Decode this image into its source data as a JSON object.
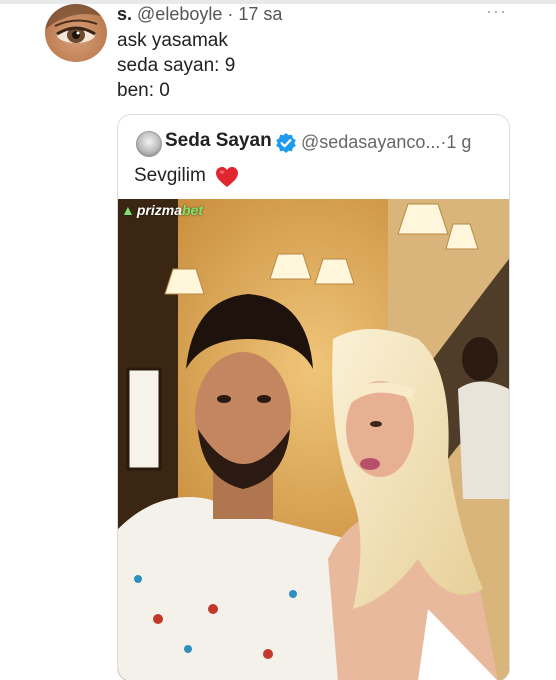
{
  "tweet": {
    "display_name": "s.",
    "handle": "@eleboyle",
    "time": "17 sa",
    "lines": [
      "ask yasamak",
      "seda sayan: 9",
      "ben: 0"
    ],
    "more_icon": "ellipsis-icon"
  },
  "quote": {
    "display_name": "Seda Sayan",
    "handle": "@sedasayanco...",
    "time": "1 g",
    "text": "Sevgilim",
    "verified_icon": "verified-badge-icon",
    "emoji": "red-heart-icon",
    "watermark": {
      "part1": "prizma",
      "part2": "bet"
    }
  },
  "colors": {
    "verified": "#1d9bf0",
    "heart": "#e0252f",
    "watermark_accent": "#7be36b"
  }
}
